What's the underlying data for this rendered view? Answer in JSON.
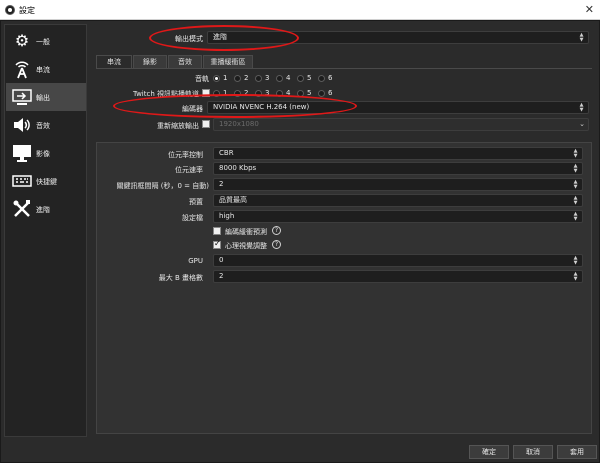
{
  "window": {
    "title": "設定",
    "close_glyph": "✕"
  },
  "sidebar": {
    "items": [
      {
        "label": "一般",
        "icon": "gear-icon",
        "glyph": "⚙",
        "active": false
      },
      {
        "label": "串流",
        "icon": "antenna-icon",
        "glyph": "📡",
        "active": false
      },
      {
        "label": "輸出",
        "icon": "monitor-output-icon",
        "glyph": "▭",
        "active": true
      },
      {
        "label": "音效",
        "icon": "speaker-icon",
        "glyph": "🔊",
        "active": false
      },
      {
        "label": "影像",
        "icon": "display-icon",
        "glyph": "🖥",
        "active": false
      },
      {
        "label": "快捷鍵",
        "icon": "keyboard-icon",
        "glyph": "⌨",
        "active": false
      },
      {
        "label": "進階",
        "icon": "tools-icon",
        "glyph": "🛠",
        "active": false
      }
    ]
  },
  "output_mode": {
    "label": "輸出模式",
    "value": "進階"
  },
  "tabs": [
    {
      "label": "串流",
      "active": true
    },
    {
      "label": "錄影",
      "active": false
    },
    {
      "label": "音效",
      "active": false
    },
    {
      "label": "重播緩衝區",
      "active": false
    }
  ],
  "audio_track": {
    "label": "音軌",
    "options": [
      "1",
      "2",
      "3",
      "4",
      "5",
      "6"
    ],
    "selected": "1"
  },
  "twitch_track": {
    "label": "Twitch 視訊點播軌道",
    "options": [
      "1",
      "2",
      "3",
      "4",
      "5",
      "6"
    ]
  },
  "encoder": {
    "label": "編碼器",
    "value": "NVIDIA NVENC H.264 (new)"
  },
  "rescale": {
    "label": "重新縮放輸出",
    "value": "1920x1080"
  },
  "rate_control": {
    "label": "位元率控制",
    "value": "CBR"
  },
  "bitrate": {
    "label": "位元速率",
    "value": "8000 Kbps"
  },
  "keyframe": {
    "label": "關鍵訊框間隔 (秒，0 = 自動)",
    "value": "2"
  },
  "preset": {
    "label": "預置",
    "value": "品質最高"
  },
  "profile": {
    "label": "設定檔",
    "value": "high"
  },
  "lookahead": {
    "label": "編碼緩衝預測",
    "checked": false,
    "help": "?"
  },
  "psycho_visual": {
    "label": "心理視覺調整",
    "checked": true,
    "help": "?"
  },
  "gpu": {
    "label": "GPU",
    "value": "0"
  },
  "max_bframes": {
    "label": "最大 B 畫格數",
    "value": "2"
  },
  "buttons": {
    "ok": "確定",
    "cancel": "取消",
    "apply": "套用"
  },
  "colors": {
    "annotation": "#e01818",
    "background": "#2b2b2b"
  }
}
